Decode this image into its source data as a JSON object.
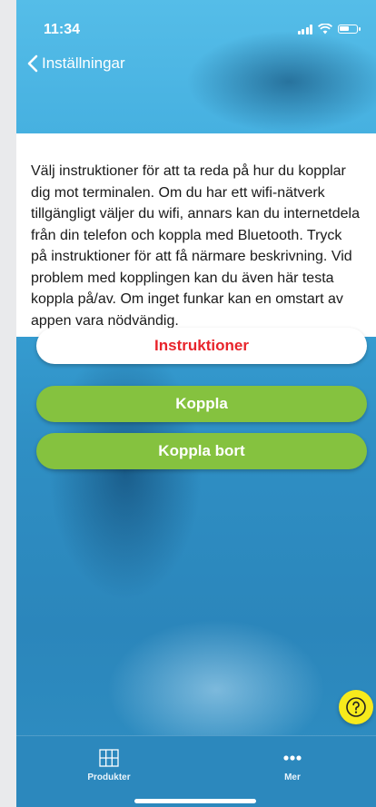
{
  "status_bar": {
    "time": "11:34"
  },
  "nav": {
    "back_label": "Inställningar"
  },
  "info": {
    "text": "Välj instruktioner för att ta reda på hur du kopplar dig mot terminalen. Om du har ett wifi-nätverk tillgängligt väljer du wifi, annars kan du internetdela från din telefon och koppla med Bluetooth. Tryck på instruktioner för att få närmare beskrivning. Vid problem med kopplingen kan du även här testa koppla på/av. Om inget funkar kan en omstart av appen vara nödvändig."
  },
  "buttons": {
    "instructions": "Instruktioner",
    "connect": "Koppla",
    "disconnect": "Koppla bort"
  },
  "tabs": [
    {
      "label": "Produkter",
      "icon": "grid-icon"
    },
    {
      "label": "Mer",
      "icon": "more-dots-icon"
    }
  ],
  "colors": {
    "primary_blue": "#2f8fc4",
    "accent_red": "#e8242b",
    "accent_green": "#85c23f",
    "help_yellow": "#f6ea1c"
  }
}
